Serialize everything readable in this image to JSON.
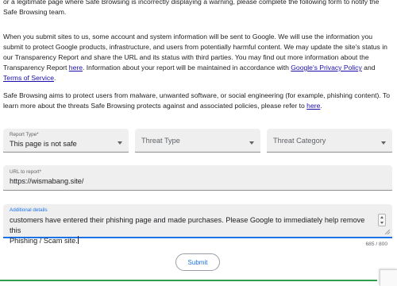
{
  "intro": {
    "p1": "or a legitimate page where Safe Browsing is incorrectly displaying a warning, please complete the following form to notify the Safe Browsing team.",
    "p2_text_1": "When you submit sites to us, some account and system information will be sent to Google. We will use the information you submit to protect Google products, infrastructure, and users from potentially harmful content. We may update the site's status in our Transparency Report and share the URL and its status with third parties. You may find out more information about the Transparency Report ",
    "p2_link_here": "here",
    "p2_text_2": ". Information about your report will be maintained in accordance with ",
    "p2_link_privacy": "Google's Privacy Policy",
    "p2_text_3": " and ",
    "p2_link_tos": "Terms of Service",
    "p2_text_4": ".",
    "p3_text_1": "Safe Browsing aims to protect users from malware, unwanted software, or social engineering (for example, phishing content). To learn more about the threats Safe Browsing protects against and associated policies, please refer to ",
    "p3_link_here": "here",
    "p3_text_2": "."
  },
  "form": {
    "report_type": {
      "label": "Report Type*",
      "value": "This page is not safe"
    },
    "threat_type": {
      "placeholder": "Threat Type"
    },
    "threat_category": {
      "placeholder": "Threat Category"
    },
    "url": {
      "label": "URL to report*",
      "value": "https://wismabang.site/"
    },
    "details": {
      "label": "Additional details",
      "line1": "customers have entered their phishing page and made purchases. Please Google to immediately help remove this",
      "line2": "Phishing / Scam site."
    },
    "char_count": "685 / 800",
    "submit_label": "Submit"
  },
  "colors": {
    "accent": "#1a73e8",
    "link": "#1a0dab",
    "footer_bar": "#2e9d4b"
  }
}
